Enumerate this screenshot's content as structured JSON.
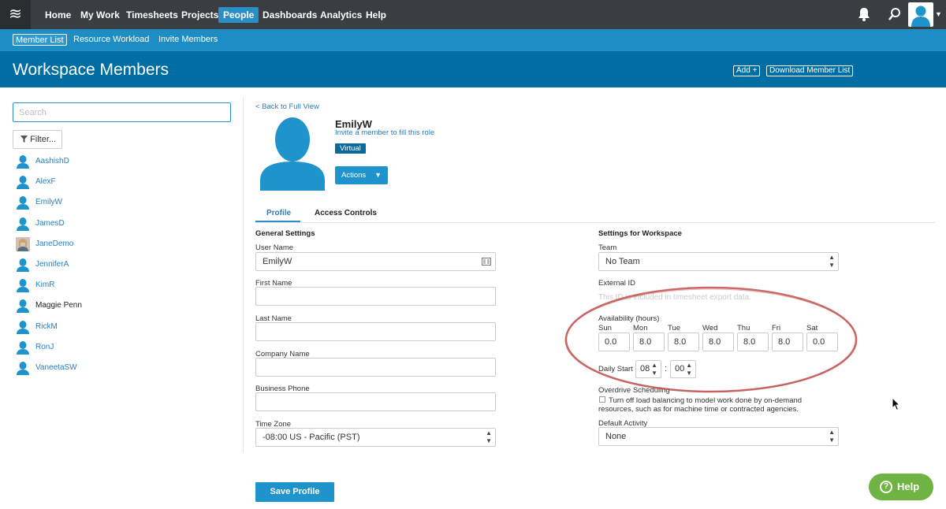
{
  "nav": {
    "logo": "≋",
    "items": [
      "Home",
      "My Work",
      "Timesheets",
      "Projects",
      "People",
      "Dashboards",
      "Analytics",
      "Help"
    ]
  },
  "subnav": {
    "items": [
      "Member List",
      "Resource Workload",
      "Invite Members"
    ]
  },
  "header": {
    "title": "Workspace Members",
    "add_label": "Add +",
    "download_label": "Download Member List"
  },
  "sidebar": {
    "search_placeholder": "Search",
    "filter_label": "Filter...",
    "members": [
      "AashishD",
      "AlexF",
      "EmilyW",
      "JamesD",
      "JaneDemo",
      "JenniferA",
      "KimR",
      "Maggie Penn",
      "RickM",
      "RonJ",
      "VaneetaSW"
    ]
  },
  "profile": {
    "back_link": "< Back to Full View",
    "name": "EmilyW",
    "invite_link": "Invite a member to fill this role",
    "badge": "Virtual",
    "actions_label": "Actions",
    "tabs": [
      "Profile",
      "Access Controls"
    ]
  },
  "general": {
    "title": "General Settings",
    "user_name_label": "User Name",
    "user_name_value": "EmilyW",
    "first_name_label": "First Name",
    "last_name_label": "Last Name",
    "company_label": "Company Name",
    "phone_label": "Business Phone",
    "timezone_label": "Time Zone",
    "timezone_value": "-08:00 US - Pacific (PST)"
  },
  "workspace": {
    "title": "Settings for Workspace",
    "team_label": "Team",
    "team_value": "No Team",
    "external_id_label": "External ID",
    "external_id_help": "This ID is included in timesheet export data.",
    "availability_label": "Availability (hours)",
    "days": [
      {
        "name": "Sun",
        "value": "0.0"
      },
      {
        "name": "Mon",
        "value": "8.0"
      },
      {
        "name": "Tue",
        "value": "8.0"
      },
      {
        "name": "Wed",
        "value": "8.0"
      },
      {
        "name": "Thu",
        "value": "8.0"
      },
      {
        "name": "Fri",
        "value": "8.0"
      },
      {
        "name": "Sat",
        "value": "0.0"
      }
    ],
    "daily_start_label": "Daily Start",
    "daily_start_hour": "08",
    "daily_start_min": "00",
    "overdrive_label": "Overdrive Scheduling",
    "overdrive_text": "Turn off load balancing to model work done by on-demand resources, such as for machine time or contracted agencies.",
    "default_activity_label": "Default Activity",
    "default_activity_value": "None"
  },
  "save_label": "Save Profile",
  "help_label": "Help",
  "colors": {
    "topnav": "#3a3d41",
    "subnav": "#1d8dc4",
    "header": "#006ea3",
    "accent": "#1f93cc",
    "help_green": "#6fb343",
    "annotation": "#c0504d"
  }
}
